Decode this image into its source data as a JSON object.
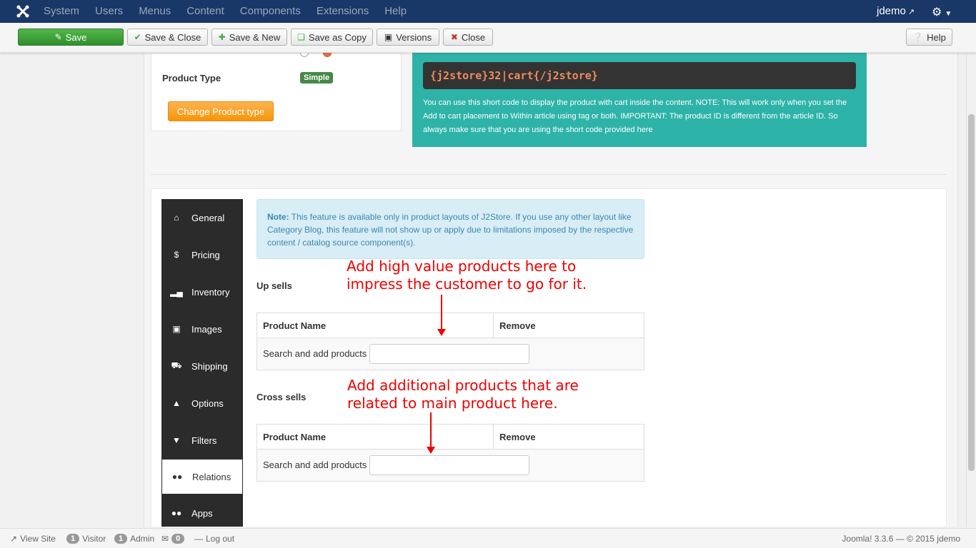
{
  "navbar": {
    "menu": [
      "System",
      "Users",
      "Menus",
      "Content",
      "Components",
      "Extensions",
      "Help"
    ],
    "user": "jdemo"
  },
  "toolbar": {
    "save": "Save",
    "save_close": "Save & Close",
    "save_new": "Save & New",
    "save_copy": "Save as Copy",
    "versions": "Versions",
    "close": "Close",
    "help": "Help"
  },
  "product": {
    "type_label": "Product Type",
    "type_value": "Simple",
    "change_button": "Change Product type"
  },
  "shortcode": {
    "code": "{j2store}32|cart{/j2store}",
    "description": "You can use this short code to display the product with cart inside the content. NOTE: This will work only when you set the Add to cart placement to Within article using tag or both. IMPORTANT: The product ID is different from the article ID. So always make sure that you are using the short code provided here"
  },
  "tabs": [
    "General",
    "Pricing",
    "Inventory",
    "Images",
    "Shipping",
    "Options",
    "Filters",
    "Relations",
    "Apps"
  ],
  "active_tab": "Relations",
  "note": {
    "label": "Note:",
    "text": "This feature is available only in product layouts of J2Store. If you use any other layout like Category Blog, this feature will not show up or apply due to limitations imposed by the respective content / catalog source component(s)."
  },
  "upsells": {
    "label": "Up sells",
    "col_name": "Product Name",
    "col_remove": "Remove",
    "search_label": "Search and add products",
    "annotation_line1": "Add high value products here to",
    "annotation_line2": "impress the customer to go for it."
  },
  "crosssells": {
    "label": "Cross sells",
    "col_name": "Product Name",
    "col_remove": "Remove",
    "search_label": "Search and add products",
    "annotation_line1": "Add additional products that are",
    "annotation_line2": "related to main product here."
  },
  "footer": {
    "view_site": "View Site",
    "visitor_count": "1",
    "visitor_label": "Visitor",
    "admin_count": "1",
    "admin_label": "Admin",
    "messages_count": "0",
    "logout": "Log out",
    "right": "Joomla! 3.3.6 — © 2015 jdemo"
  },
  "colors": {
    "navbar": "#1a3867",
    "save_button": "#3c9a37",
    "shortcode_panel": "#2eb3a8",
    "annotation": "#ee0000",
    "change_button": "#f89406"
  }
}
